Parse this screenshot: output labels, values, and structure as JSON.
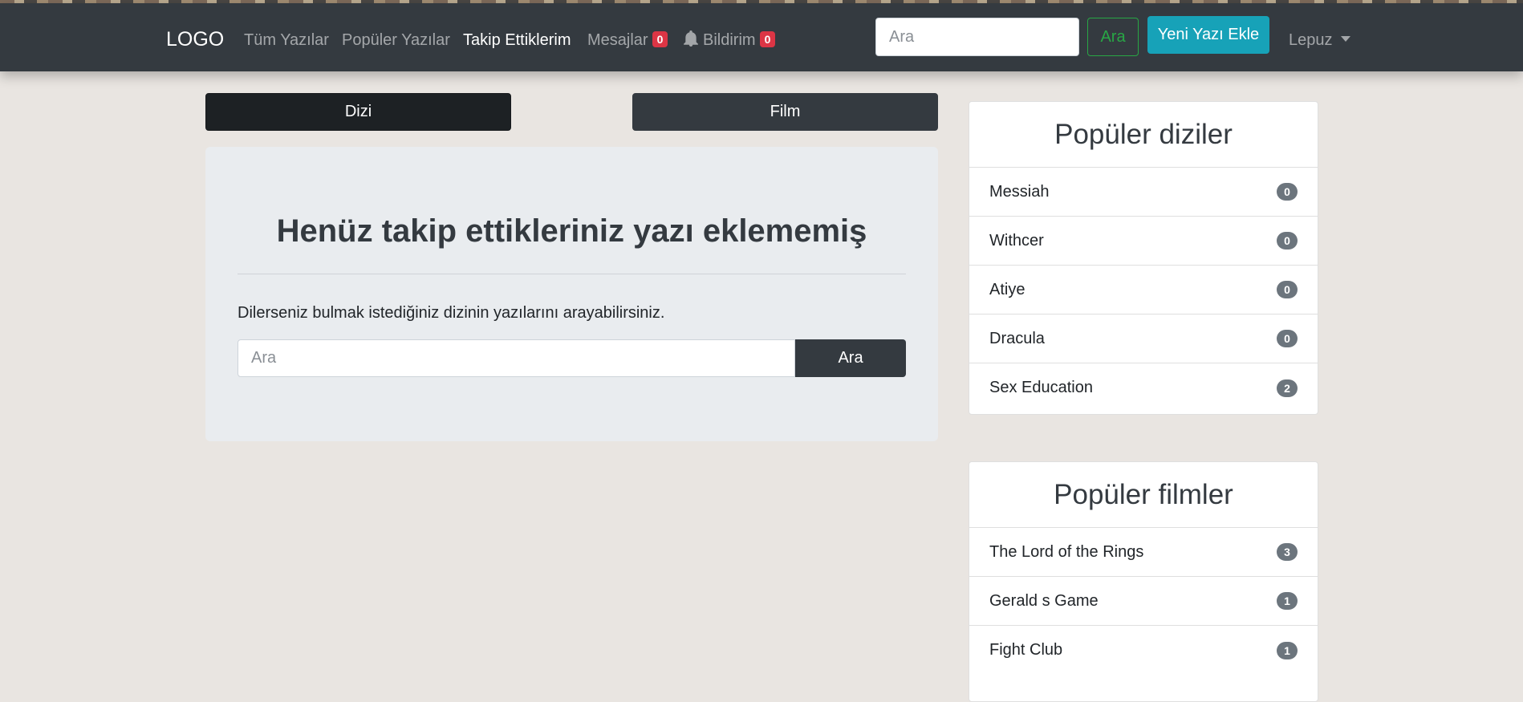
{
  "navbar": {
    "brand": "LOGO",
    "links": [
      {
        "label": "Tüm Yazılar"
      },
      {
        "label": "Popüler Yazılar"
      },
      {
        "label": "Takip Ettiklerim"
      },
      {
        "label": "Mesajlar",
        "badge": "0"
      },
      {
        "label": "Bildirim",
        "badge": "0"
      }
    ],
    "search_placeholder": "Ara",
    "search_button": "Ara",
    "new_post_button": "Yeni Yazı Ekle",
    "user": "Lepuz"
  },
  "tabs": {
    "series": "Dizi",
    "films": "Film"
  },
  "main": {
    "title": "Henüz takip ettikleriniz yazı eklememiş",
    "text": "Dilerseniz bulmak istediğiniz dizinin yazılarını arayabilirsiniz.",
    "search_placeholder": "Ara",
    "search_button": "Ara"
  },
  "popular_series": {
    "title": "Popüler diziler",
    "items": [
      {
        "name": "Messiah",
        "count": "0"
      },
      {
        "name": "Withcer",
        "count": "0"
      },
      {
        "name": "Atiye",
        "count": "0"
      },
      {
        "name": "Dracula",
        "count": "0"
      },
      {
        "name": "Sex Education",
        "count": "2"
      }
    ]
  },
  "popular_films": {
    "title": "Popüler filmler",
    "items": [
      {
        "name": "The Lord of the Rings",
        "count": "3"
      },
      {
        "name": "Gerald s Game",
        "count": "1"
      },
      {
        "name": "Fight Club",
        "count": "1"
      }
    ]
  },
  "colors": {
    "navbar": "#343a40",
    "danger": "#dc3545",
    "success": "#28a745",
    "info": "#17a2b8",
    "badge": "#6c757d",
    "background": "#e9e5e1"
  }
}
